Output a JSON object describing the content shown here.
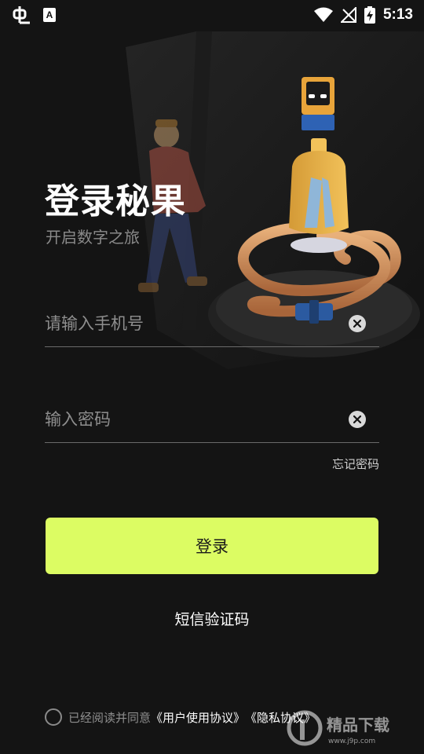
{
  "status_bar": {
    "time": "5:13",
    "icons": [
      "app-bug-icon",
      "accessibility-a-icon",
      "wifi-icon",
      "no-signal-icon",
      "battery-charging-icon"
    ]
  },
  "header": {
    "title": "登录秘果",
    "subtitle": "开启数字之旅"
  },
  "form": {
    "phone_placeholder": "请输入手机号",
    "phone_value": "",
    "password_placeholder": "输入密码",
    "password_value": "",
    "forgot_label": "忘记密码",
    "login_label": "登录",
    "sms_login_label": "短信验证码"
  },
  "agreement": {
    "prefix": "已经阅读并同意",
    "user_agreement": "《用户使用协议》",
    "privacy_agreement": "《隐私协议》",
    "checked": false
  },
  "watermark": {
    "text": "精品下载",
    "url_text": "www.j9p.com"
  },
  "colors": {
    "background": "#141414",
    "accent": "#dcfc63",
    "muted_text": "#8e8e8e"
  }
}
